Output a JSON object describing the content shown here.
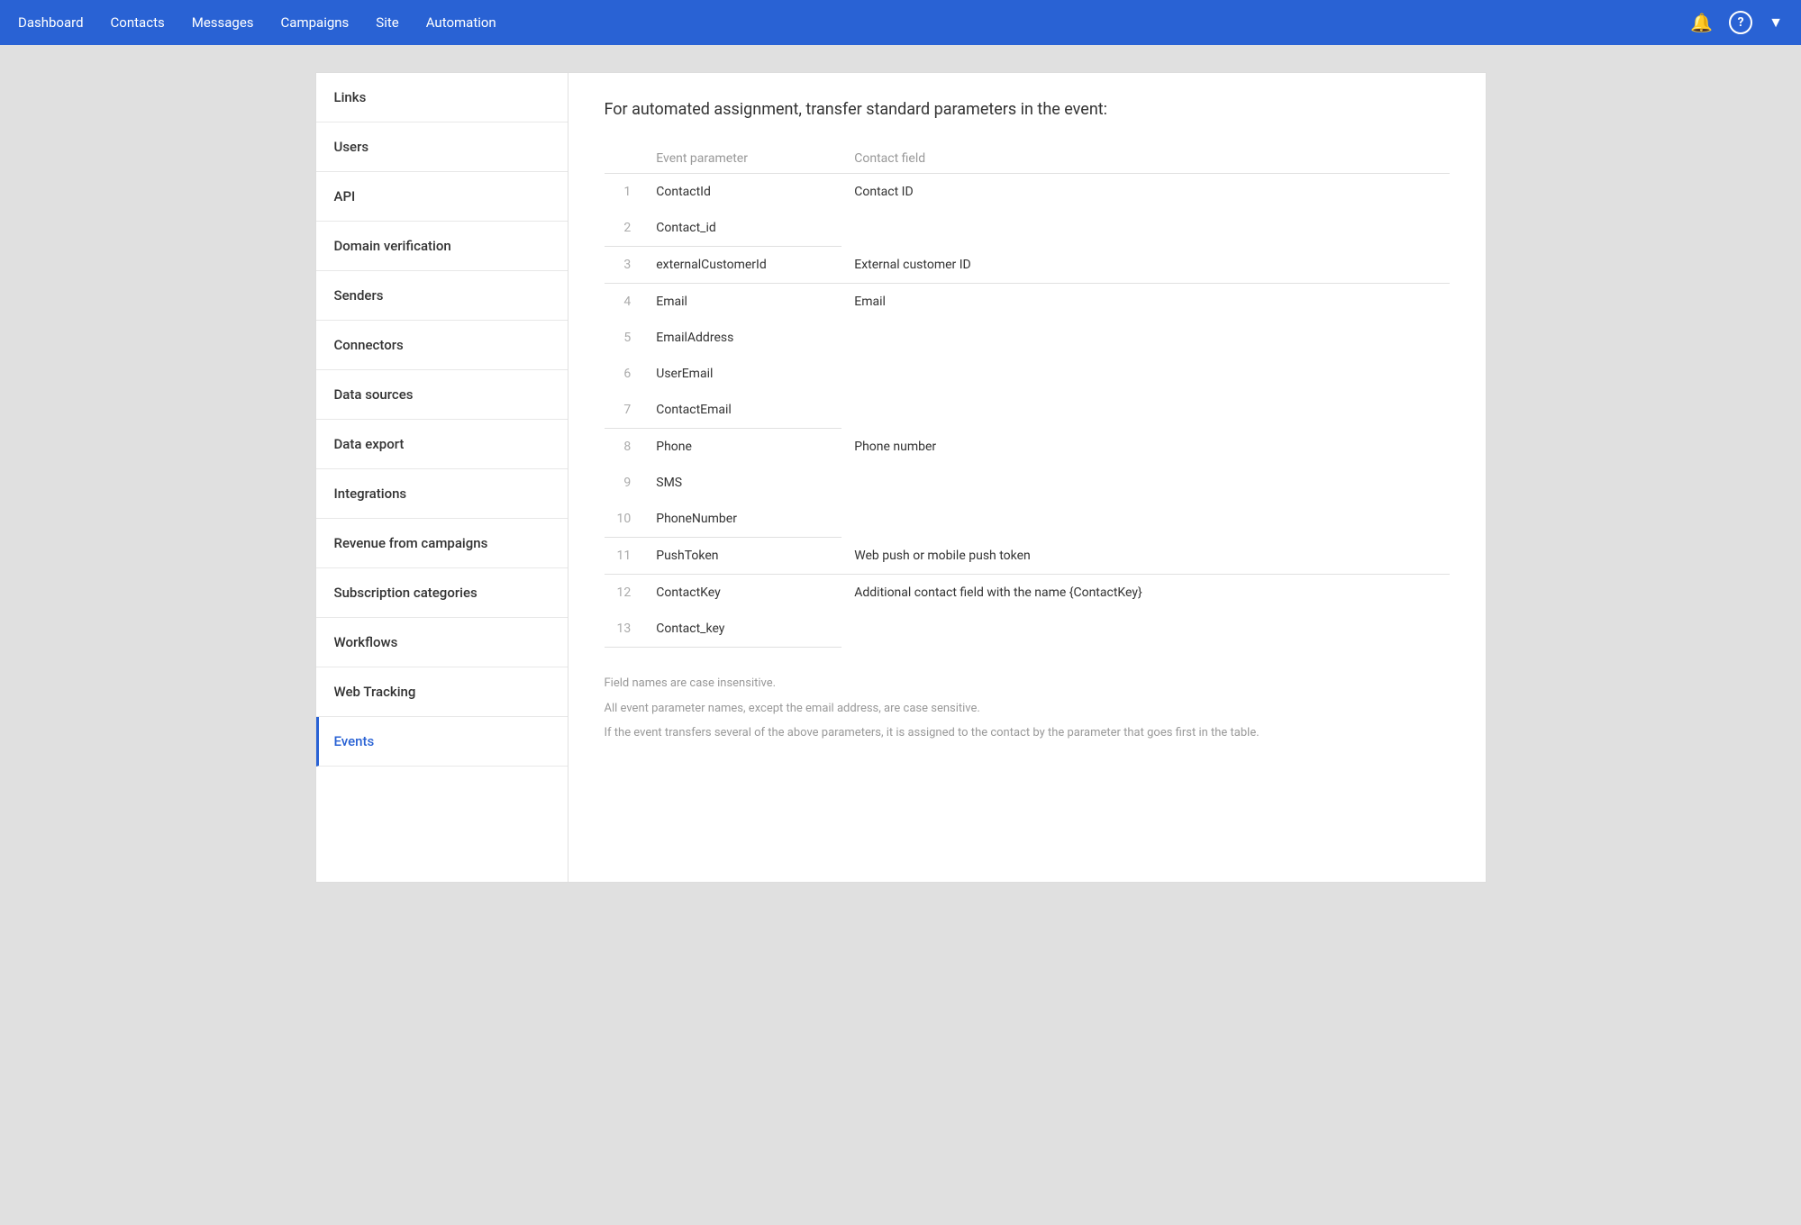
{
  "topnav": {
    "links": [
      {
        "label": "Dashboard",
        "id": "dashboard"
      },
      {
        "label": "Contacts",
        "id": "contacts"
      },
      {
        "label": "Messages",
        "id": "messages"
      },
      {
        "label": "Campaigns",
        "id": "campaigns"
      },
      {
        "label": "Site",
        "id": "site"
      },
      {
        "label": "Automation",
        "id": "automation"
      }
    ],
    "icons": {
      "bell": "🔔",
      "help": "?",
      "dropdown": "▼"
    }
  },
  "sidebar": {
    "items": [
      {
        "label": "Links",
        "id": "links",
        "active": false
      },
      {
        "label": "Users",
        "id": "users",
        "active": false
      },
      {
        "label": "API",
        "id": "api",
        "active": false
      },
      {
        "label": "Domain verification",
        "id": "domain-verification",
        "active": false
      },
      {
        "label": "Senders",
        "id": "senders",
        "active": false
      },
      {
        "label": "Connectors",
        "id": "connectors",
        "active": false
      },
      {
        "label": "Data sources",
        "id": "data-sources",
        "active": false
      },
      {
        "label": "Data export",
        "id": "data-export",
        "active": false
      },
      {
        "label": "Integrations",
        "id": "integrations",
        "active": false
      },
      {
        "label": "Revenue from campaigns",
        "id": "revenue-from-campaigns",
        "active": false
      },
      {
        "label": "Subscription categories",
        "id": "subscription-categories",
        "active": false
      },
      {
        "label": "Workflows",
        "id": "workflows",
        "active": false
      },
      {
        "label": "Web Tracking",
        "id": "web-tracking",
        "active": false
      },
      {
        "label": "Events",
        "id": "events",
        "active": true
      }
    ]
  },
  "content": {
    "title": "For automated assignment, transfer standard parameters in the event:",
    "table": {
      "col_event": "Event parameter",
      "col_contact": "Contact field",
      "rows": [
        {
          "group": [
            {
              "num": "1",
              "param": "ContactId"
            },
            {
              "num": "2",
              "param": "Contact_id"
            }
          ],
          "contact_field": "Contact ID"
        },
        {
          "group": [
            {
              "num": "3",
              "param": "externalCustomerId"
            }
          ],
          "contact_field": "External customer ID"
        },
        {
          "group": [
            {
              "num": "4",
              "param": "Email"
            },
            {
              "num": "5",
              "param": "EmailAddress"
            },
            {
              "num": "6",
              "param": "UserEmail"
            },
            {
              "num": "7",
              "param": "ContactEmail"
            }
          ],
          "contact_field": "Email"
        },
        {
          "group": [
            {
              "num": "8",
              "param": "Phone"
            },
            {
              "num": "9",
              "param": "SMS"
            },
            {
              "num": "10",
              "param": "PhoneNumber"
            }
          ],
          "contact_field": "Phone number"
        },
        {
          "group": [
            {
              "num": "11",
              "param": "PushToken"
            }
          ],
          "contact_field": "Web push or mobile push token"
        },
        {
          "group": [
            {
              "num": "12",
              "param": "ContactKey"
            },
            {
              "num": "13",
              "param": "Contact_key"
            }
          ],
          "contact_field": "Additional contact field with the name {ContactKey}"
        }
      ]
    },
    "notes": [
      "Field names are case insensitive.",
      "All event parameter names, except the email address, are case sensitive.",
      "If the event transfers several of the above parameters, it is assigned to the contact by the parameter that goes first in the table."
    ]
  }
}
